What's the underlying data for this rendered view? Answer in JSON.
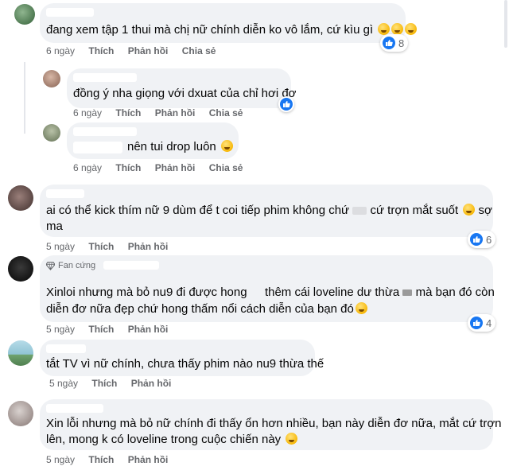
{
  "comments": [
    {
      "text_lines": [
        "đang xem tập 1 thui mà chị nữ chính diễn ko vô lắm, cứ kìu gì"
      ],
      "emoji_count": 3,
      "time": "6 ngày",
      "actions": [
        "Thích",
        "Phản hồi",
        "Chia sẻ"
      ],
      "likes": "8"
    },
    {
      "text_lines": [
        "đồng ý nha giọng với dxuat của chỉ hơi đơ"
      ],
      "emoji_count": 0,
      "time": "6 ngày",
      "actions": [
        "Thích",
        "Phản hồi",
        "Chia sẻ"
      ]
    },
    {
      "text_lines": [
        "nên tui drop luôn"
      ],
      "emoji_count": 1,
      "time": "6 ngày",
      "actions": [
        "Thích",
        "Phản hồi",
        "Chia sẻ"
      ]
    },
    {
      "text_lines": [
        "ai có thể kick thím nữ 9 dùm để t coi tiếp phim không chứ",
        "cứ trợn mắt suốt",
        "sợ",
        "ma"
      ],
      "time": "5 ngày",
      "actions": [
        "Thích",
        "Phản hồi"
      ],
      "likes": "6"
    },
    {
      "badge": "Fan cứng",
      "text_lines": [
        "Xinloi nhưng mà bỏ nu9 đi được hong",
        "thêm cái loveline dư thừa",
        "mà bạn đó còn",
        "diễn đơ nữa đẹp chứ hong thấm nổi cách diễn của bạn đó"
      ],
      "time": "5 ngày",
      "actions": [
        "Thích",
        "Phản hồi"
      ],
      "likes": "4"
    },
    {
      "text_lines": [
        "tắt TV vì nữ chính, chưa thấy phim nào nu9 thừa thế"
      ],
      "time": "5 ngày",
      "actions": [
        "Thích",
        "Phản hồi"
      ]
    },
    {
      "text_lines": [
        "Xin lỗi nhưng mà bỏ nữ chính đi thấy ổn hơn nhiều, bạn này diễn đơ nữa, mắt cứ trợn",
        "lên, mong k có loveline trong cuộc chiến này"
      ],
      "time": "5 ngày",
      "actions": [
        "Thích",
        "Phản hồi"
      ]
    }
  ],
  "icons": {
    "like": "thumbs-up-icon",
    "fan": "diamond-icon",
    "emoji": "face-emoji-icon"
  },
  "colors": {
    "bubble": "#f0f2f5",
    "like_blue": "#1877f2",
    "meta_gray": "#65676b"
  }
}
